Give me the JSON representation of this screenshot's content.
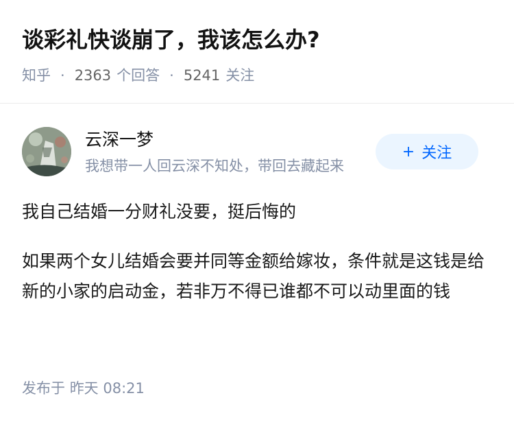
{
  "question": {
    "title": "谈彩礼快谈崩了，我该怎么办?",
    "source": "知乎",
    "answers_count": "2363",
    "answers_label": "个回答",
    "followers_count": "5241",
    "followers_label": "关注"
  },
  "answer": {
    "author": {
      "name": "云深一梦",
      "bio": "我想带一人回云深不知处，带回去藏起来",
      "follow_label": "关注",
      "follow_icon": "plus-icon"
    },
    "paragraphs": [
      "我自己结婚一分财礼没要，挺后悔的",
      "如果两个女儿结婚会要并同等金额给嫁妆，条件就是这钱是给新的小家的启动金，若非万不得已谁都不可以动里面的钱"
    ],
    "publish": {
      "label": "发布于",
      "time": "昨天 08:21"
    }
  },
  "colors": {
    "accent": "#0066ff",
    "follow_bg": "#ebf5ff",
    "meta": "#8590a6"
  }
}
